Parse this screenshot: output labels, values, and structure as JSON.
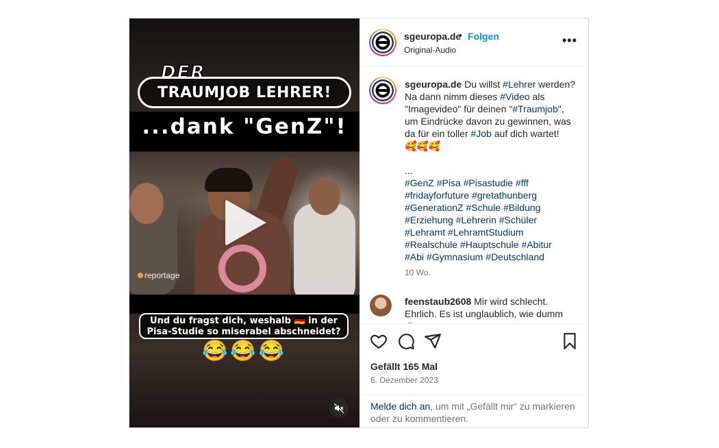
{
  "video": {
    "title_top": "DER",
    "title_pill": "TRAUMJOB LEHRER!",
    "title_genz": "...dank \"GenZ\"!",
    "brand": "reportage",
    "caption_line1": "Und du fragst dich, weshalb 🇩🇪 in der",
    "caption_line2": "Pisa-Studie so miserabel abschneidet?",
    "emojis": "😂😂😂",
    "play_icon": "play-icon",
    "mute_icon": "muted-speaker-icon"
  },
  "header": {
    "username": "sgeuropa.de",
    "separator": "•",
    "follow_label": "Folgen",
    "audio": "Original-Audio",
    "more_icon": "more-options-icon",
    "more_label": "•••"
  },
  "caption": {
    "username": "sgeuropa.de",
    "t1": " Du willst ",
    "h1": "#Lehrer",
    "t2": " werden? Na dann nimm dieses ",
    "h2": "#Video",
    "t3": " als \"Imagevideo\" für deinen \"",
    "h3": "#Traumjob",
    "t4": "\", um Eindrücke davon zu gewinnen, was da für ein toller ",
    "h4": "#Job",
    "t5": " auf dich wartet!",
    "emoji_line": "🥰🥰🥰",
    "ellipsis": "...",
    "hashtags": [
      "#GenZ",
      "#Pisa",
      "#Pisastudie",
      "#fff",
      "#fridayforfuture",
      "#gretathunberg",
      "#GenerationZ",
      "#Schule",
      "#Bildung",
      "#Erziehung",
      "#Lehrerin",
      "#Schüler",
      "#Lehramt",
      "#LehramtStudium",
      "#Realschule",
      "#Hauptschule",
      "#Abitur",
      "#Abi",
      "#Gymnasium",
      "#Deutschland"
    ],
    "time": "10 Wo."
  },
  "comment": {
    "username": "feenstaub2608",
    "text": " Mir wird schlecht. Ehrlich. Es ist unglaublich, wie dumm diese"
  },
  "actions": {
    "like_icon": "heart-icon",
    "comment_icon": "comment-icon",
    "share_icon": "share-icon",
    "save_icon": "bookmark-icon",
    "likes": "Gefällt 165 Mal",
    "date": "6. Dezember 2023"
  },
  "login": {
    "link": "Melde dich an",
    "text": ", um mit „Gefällt mir“ zu markieren oder zu kommentieren."
  },
  "colors": {
    "accent": "#0095f6",
    "hashtag": "#00376b",
    "muted": "#737373",
    "border": "#dbdbdb"
  }
}
